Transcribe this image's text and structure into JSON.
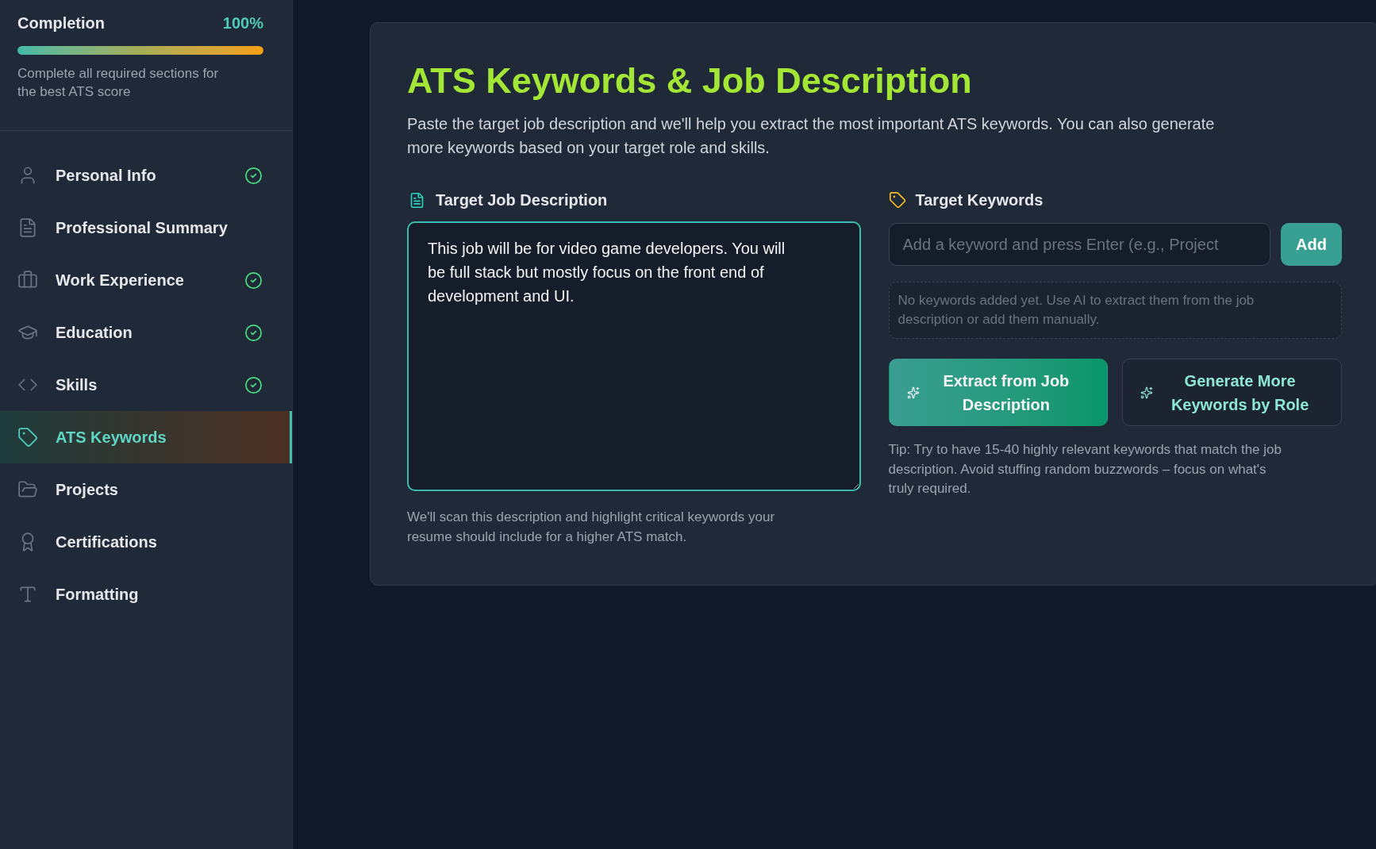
{
  "sidebar": {
    "completion": {
      "label": "Completion",
      "value": "100%",
      "level": 1,
      "hint": "Complete all required sections for the best ATS score"
    },
    "items": [
      {
        "label": "Personal Info",
        "complete": true,
        "selected": false
      },
      {
        "label": "Professional Summary",
        "complete": false,
        "selected": false
      },
      {
        "label": "Work Experience",
        "complete": true,
        "selected": false
      },
      {
        "label": "Education",
        "complete": true,
        "selected": false
      },
      {
        "label": "Skills",
        "complete": true,
        "selected": false
      },
      {
        "label": "ATS Keywords",
        "complete": false,
        "selected": true
      },
      {
        "label": "Projects",
        "complete": false,
        "selected": false
      },
      {
        "label": "Certifications",
        "complete": false,
        "selected": false
      },
      {
        "label": "Formatting",
        "complete": false,
        "selected": false
      }
    ]
  },
  "main": {
    "title": "ATS Keywords & Job Description",
    "description": "Paste the target job description and we'll help you extract the most important ATS keywords. You can also generate more keywords based on your target role and skills.",
    "job_description": {
      "label": "Target Job Description",
      "value": "This job will be for video game developers. You will be full stack but mostly focus on the front end of development and UI.",
      "hint": "We'll scan this description and highlight critical keywords your resume should include for a higher ATS match."
    },
    "keywords": {
      "label": "Target Keywords",
      "input": {
        "placeholder": "Add a keyword and press Enter (e.g., Project"
      },
      "add_button": "Add",
      "empty_message": "No keywords added yet. Use AI to extract them from the job description or add them manually.",
      "buttons": [
        {
          "label": "Extract from Job Description",
          "kind": "primary"
        },
        {
          "label": "Generate More Keywords by Role",
          "kind": "secondary"
        }
      ],
      "tip": "Tip: Try to have 15-40 highly relevant keywords that match the job description. Avoid stuffing random buzzwords – focus on what's truly required."
    }
  }
}
